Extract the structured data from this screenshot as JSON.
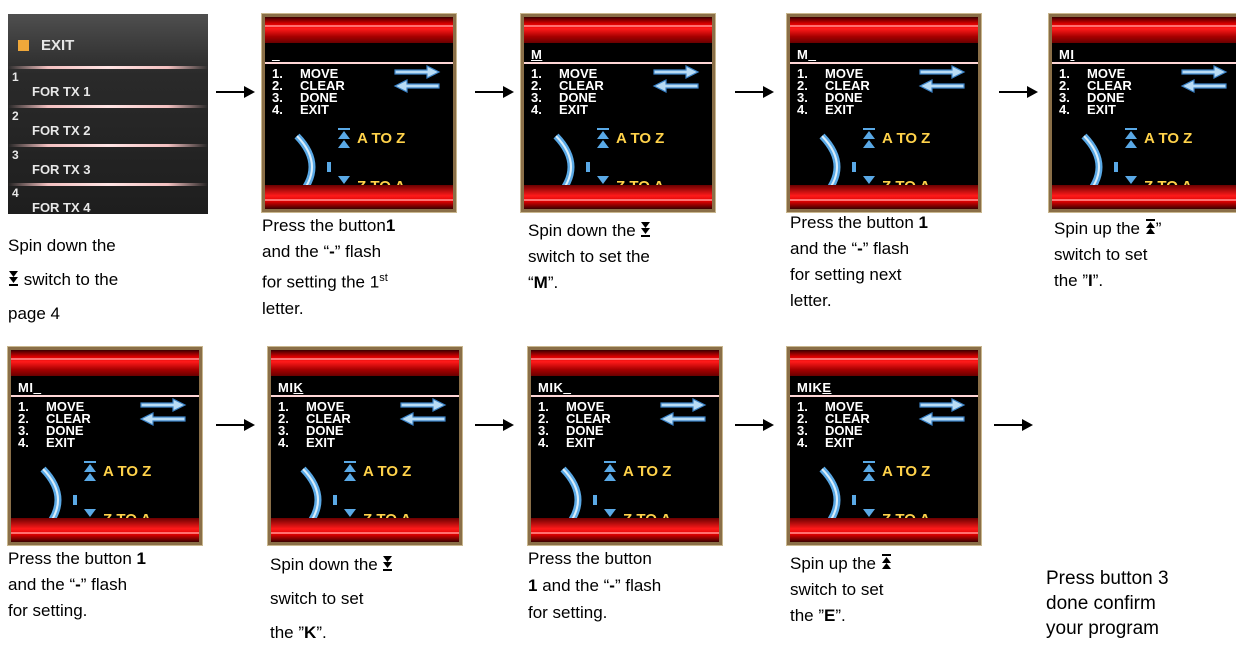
{
  "menu": {
    "exit_label": "EXIT",
    "items": [
      {
        "index": "1",
        "label": "FOR TX 1"
      },
      {
        "index": "2",
        "label": "FOR TX 2"
      },
      {
        "index": "3",
        "label": "FOR TX 3"
      },
      {
        "index": "4",
        "label": "FOR TX 4"
      }
    ]
  },
  "screen_options": [
    {
      "num": "1.",
      "label": "MOVE"
    },
    {
      "num": "2.",
      "label": "CLEAR"
    },
    {
      "num": "3.",
      "label": "DONE"
    },
    {
      "num": "4.",
      "label": "EXIT"
    }
  ],
  "wheel": {
    "up_label": "A TO Z",
    "down_label": "Z TO A"
  },
  "screens": [
    {
      "name_text": "",
      "underlined": "_"
    },
    {
      "name_text": "",
      "underlined": "M"
    },
    {
      "name_text": "M",
      "underlined": "_"
    },
    {
      "name_text": "M",
      "underlined": "I"
    },
    {
      "name_text": "MI",
      "underlined": "_"
    },
    {
      "name_text": "MI",
      "underlined": "K"
    },
    {
      "name_text": "MIK",
      "underlined": "_"
    },
    {
      "name_text": "MIK",
      "underlined": "E"
    }
  ],
  "captions": {
    "c0": {
      "line1": "Spin down the",
      "line2": " switch to the",
      "line3": "page 4"
    },
    "c1": {
      "a": "Press the button",
      "b": "1",
      "c": "and the “",
      "d": "-",
      "e": "” flash",
      "f": "for setting the 1",
      "g": "st",
      "h": "letter."
    },
    "c2": {
      "a": "Spin down the ",
      "b": "switch to set the",
      "c": "“",
      "d": "M",
      "e": "”."
    },
    "c3": {
      "a": "Press the button ",
      "b": "1",
      "c": "and the “",
      "d": "-",
      "e": "” flash",
      "f": "for setting next",
      "g": "letter."
    },
    "c4": {
      "a": "Spin up the ",
      "a2": "”",
      "b": "switch to set",
      "c": "the ”",
      "d": "I",
      "e": "”."
    },
    "c5": {
      "a": "Press the button ",
      "b": "1",
      "c": "and the “",
      "d": "-",
      "e": "” flash",
      "f": "for setting."
    },
    "c6": {
      "a": "Spin down the ",
      "b": "switch to set",
      "c": "the ”",
      "d": "K",
      "e": "”."
    },
    "c7": {
      "a": "Press the button",
      "b": "1",
      "c": " and the “",
      "d": "-",
      "e": "” flash",
      "f": "for setting."
    },
    "c8": {
      "a": "Spin up the ",
      "b": "switch to set",
      "c": "the ”",
      "d": "E",
      "e": "”."
    },
    "c9": {
      "line1": "Press button 3",
      "line2": "done confirm",
      "line3": "your program"
    }
  },
  "colors": {
    "screen_band": "#d60000",
    "accent_yellow": "#ffd24a",
    "wheel_blue": "#5aa9e6",
    "frame": "#8a6f48"
  }
}
